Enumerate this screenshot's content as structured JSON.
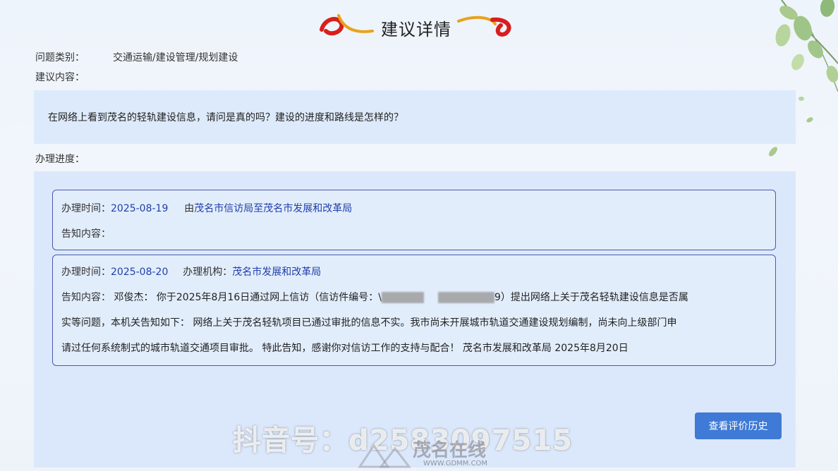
{
  "page": {
    "title": "建议详情"
  },
  "fields": {
    "category_label": "问题类别：",
    "category_value": "交通运输/建设管理/规划建设",
    "content_label": "建议内容：",
    "content_value": "在网络上看到茂名的轻轨建设信息，请问是真的吗？建设的进度和路线是怎样的？",
    "progress_label": "办理进度："
  },
  "progress": [
    {
      "time_label": "办理时间：",
      "time_value": "2025-08-19",
      "route_prefix": "由",
      "route_value": "茂名市信访局至茂名市发展和改革局",
      "notice_label": "告知内容："
    },
    {
      "time_label": "办理时间：",
      "time_value": "2025-08-20",
      "org_label": "办理机构：",
      "org_value": "茂名市发展和改革局",
      "notice_label": "告知内容：",
      "notice_part1": "邓俊杰：  你于2025年8月16日通过网上信访（信访件编号：\\",
      "notice_part2": "9）提出网络上关于茂名轻轨建设信息是否属",
      "notice_line2": "实等问题，本机关告知如下：  网络上关于茂名轻轨项目已通过审批的信息不实。我市尚未开展城市轨道交通建设规划编制，尚未向上级部门申",
      "notice_line3": "请过任何系统制式的城市轨道交通项目审批。 特此告知，感谢你对信访工作的支持与配合！ 茂名市发展和改革局 2025年8月20日"
    }
  ],
  "actions": {
    "review_history_button": "查看评价历史"
  },
  "watermarks": {
    "douyin": "抖音号：d2583097515",
    "site_name": "茂名在线",
    "site_url": "WWW.GDMM.COM"
  },
  "colors": {
    "accent_blue": "#1f3fa8",
    "button_blue": "#3e7ad6",
    "panel_bg": "#dbe8fb",
    "card_border": "#4a5aa8"
  }
}
